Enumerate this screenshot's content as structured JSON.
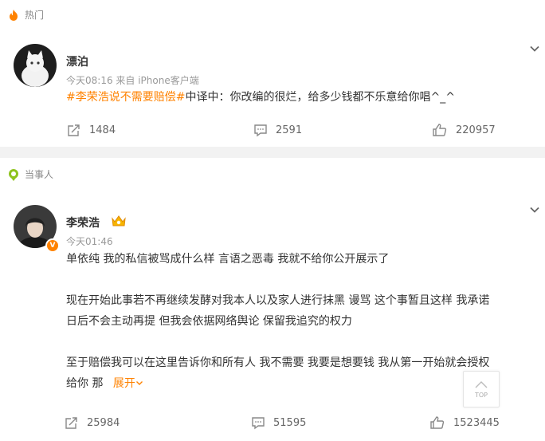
{
  "hot_section": {
    "label": "热门",
    "post": {
      "author": "漂泊",
      "meta": "今天08:16  来自 iPhone客户端",
      "topic": "#李荣浩说不需要赔偿#",
      "text": "中译中：你改编的很烂，给多少钱都不乐意给你唱^_^",
      "reposts": "1484",
      "comments": "2591",
      "likes": "220957"
    }
  },
  "party_section": {
    "label": "当事人",
    "post": {
      "author": "李荣浩",
      "verified_badge": "V",
      "meta": "今天01:46",
      "line1": "单依纯 我的私信被骂成什么样 言语之恶毒 我就不给你公开展示了",
      "line2": "现在开始此事若不再继续发酵对我本人以及家人进行抹黑 谩骂 这个事暂且这样 我承诺",
      "line3": "日后不会主动再提 但我会依据网络舆论 保留我追究的权力",
      "line4": "至于赔偿我可以在这里告诉你和所有人 我不需要 我要是想要钱 我从第一开始就会授权",
      "line5": "给你 那",
      "expand": "展开",
      "reposts": "25984",
      "comments": "51595",
      "likes": "1523445"
    }
  },
  "back_to_top": "TOP",
  "colors": {
    "accent": "#ff8200",
    "meta": "#999999",
    "separator": "#f2f2f2"
  },
  "icons": [
    "fire-icon",
    "chevron-down-icon",
    "repost-icon",
    "comment-icon",
    "like-icon",
    "party-badge-icon",
    "crown-badge-icon"
  ]
}
